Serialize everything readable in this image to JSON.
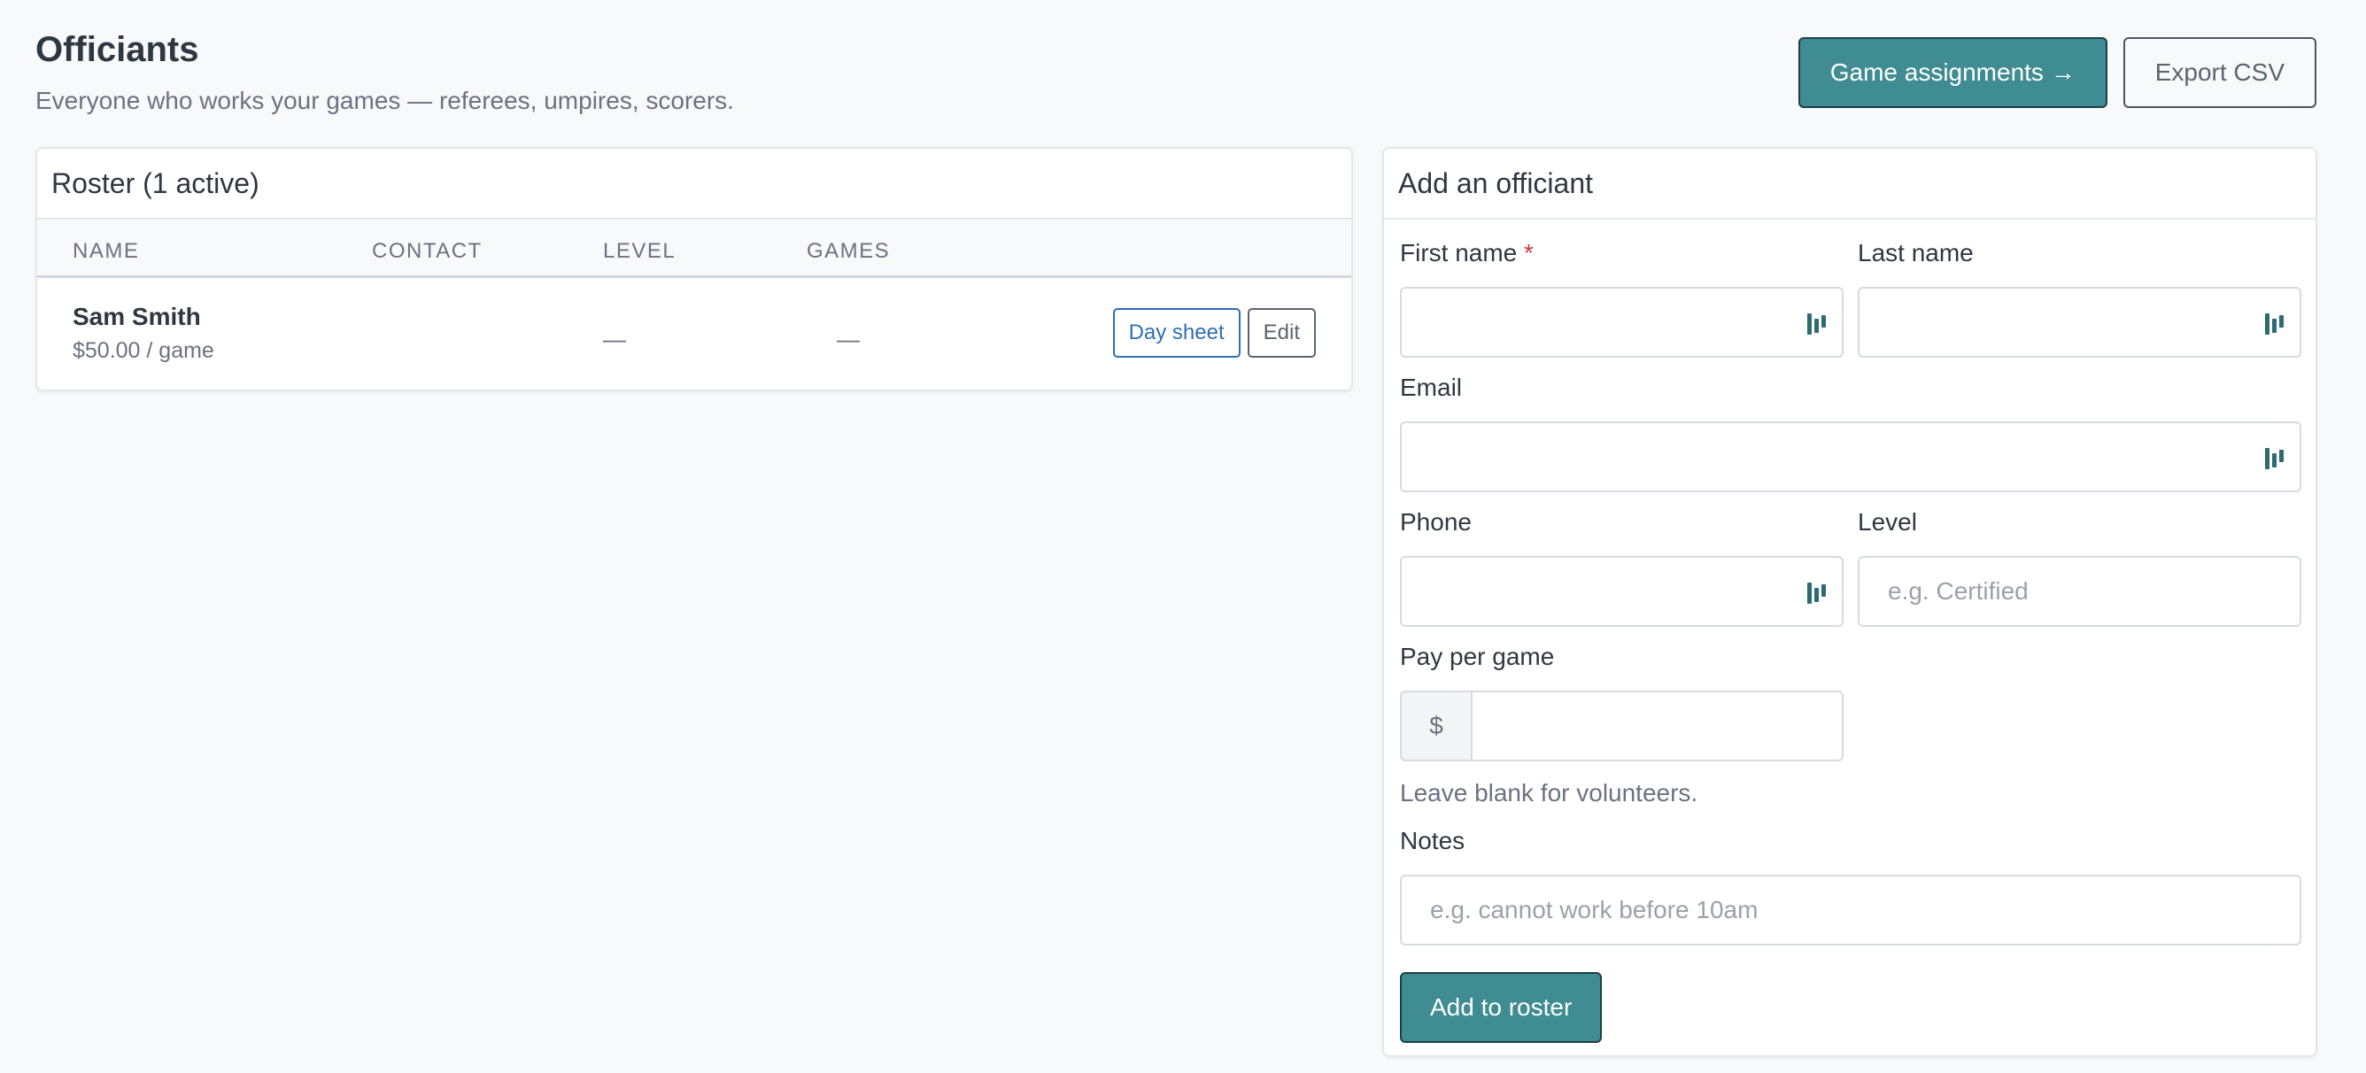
{
  "header": {
    "title": "Officiants",
    "subtitle": "Everyone who works your games — referees, umpires, scorers.",
    "game_assignments_label": "Game assignments →",
    "export_label": "Export CSV"
  },
  "roster": {
    "title": "Roster (1 active)",
    "columns": [
      "NAME",
      "CONTACT",
      "LEVEL",
      "GAMES"
    ],
    "rows": [
      {
        "name": "Sam Smith",
        "pay": "$50.00 / game",
        "contact": "",
        "level": "—",
        "games": "—",
        "day_sheet_label": "Day sheet",
        "edit_label": "Edit"
      }
    ]
  },
  "add_form": {
    "title": "Add an officiant",
    "first_name_label": "First name",
    "required_marker": "*",
    "last_name_label": "Last name",
    "email_label": "Email",
    "phone_label": "Phone",
    "level_label": "Level",
    "level_placeholder": "e.g. Certified",
    "pay_label": "Pay per game",
    "currency_prefix": "$",
    "pay_hint": "Leave blank for volunteers.",
    "notes_label": "Notes",
    "notes_placeholder": "e.g. cannot work before 10am",
    "submit_label": "Add to roster"
  },
  "colors": {
    "accent": "#3f8c92",
    "link": "#2f6fb5",
    "required": "#d0343f",
    "background": "#f8f9fb"
  },
  "icons": {
    "field_autofill": "password-manager-icon"
  }
}
